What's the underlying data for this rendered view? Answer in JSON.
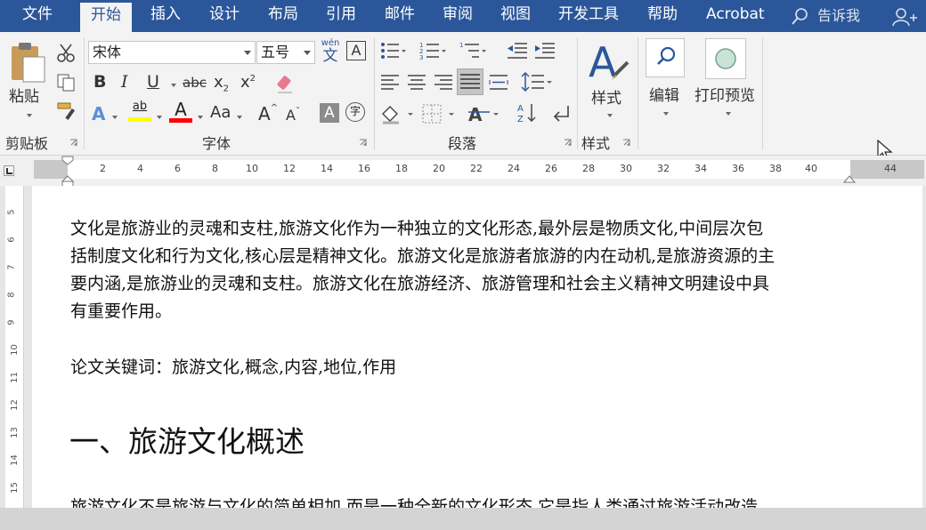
{
  "tabs": [
    {
      "label": "文件"
    },
    {
      "label": "开始"
    },
    {
      "label": "插入"
    },
    {
      "label": "设计"
    },
    {
      "label": "布局"
    },
    {
      "label": "引用"
    },
    {
      "label": "邮件"
    },
    {
      "label": "审阅"
    },
    {
      "label": "视图"
    },
    {
      "label": "开发工具"
    },
    {
      "label": "帮助"
    },
    {
      "label": "Acrobat"
    }
  ],
  "tell_me": "告诉我",
  "ribbon": {
    "clipboard": {
      "paste": "粘贴",
      "group": "剪贴板"
    },
    "font": {
      "name": "宋体",
      "size": "五号",
      "group": "字体",
      "bold": "B",
      "italic": "I",
      "underline": "U",
      "strike": "abc",
      "sub": "x",
      "sup": "x",
      "clear_case": "Aa",
      "wen": "wén",
      "wen_char": "文",
      "char_border": "A",
      "grow": "A",
      "shrink": "A",
      "shade": "A",
      "circle": "字",
      "text_effect": "A",
      "highlight": "ab",
      "font_color": "A"
    },
    "paragraph": {
      "group": "段落"
    },
    "styles": {
      "label": "样式",
      "group": "样式"
    },
    "editing": {
      "label": "编辑"
    },
    "print": {
      "label": "打印预览"
    }
  },
  "ruler": {
    "ticks": [
      "2",
      "4",
      "6",
      "8",
      "10",
      "12",
      "14",
      "16",
      "18",
      "20",
      "22",
      "24",
      "26",
      "28",
      "30",
      "32",
      "34",
      "36",
      "38",
      "40",
      "44"
    ]
  },
  "vruler": {
    "ticks": [
      "5",
      "6",
      "7",
      "8",
      "9",
      "10",
      "11",
      "12",
      "13",
      "14",
      "15"
    ]
  },
  "document": {
    "lines": [
      "文化是旅游业的灵魂和支柱,旅游文化作为一种独立的文化形态,最外层是物质文化,中间层次包",
      "括制度文化和行为文化,核心层是精神文化。旅游文化是旅游者旅游的内在动机,是旅游资源的主",
      "要内涵,是旅游业的灵魂和支柱。旅游文化在旅游经济、旅游管理和社会主义精神文明建设中具",
      "有重要作用。"
    ],
    "keywords": "论文关键词：旅游文化,概念,内容,地位,作用",
    "heading": "一、旅游文化概述",
    "next_line": "旅游文化不是旅游与文化的简单相加,而是一种全新的文化形态,它是指人类通过旅游活动改造"
  },
  "colors": {
    "brand": "#2b579a",
    "highlight": "#ffff00",
    "font_color": "#ff0000"
  }
}
